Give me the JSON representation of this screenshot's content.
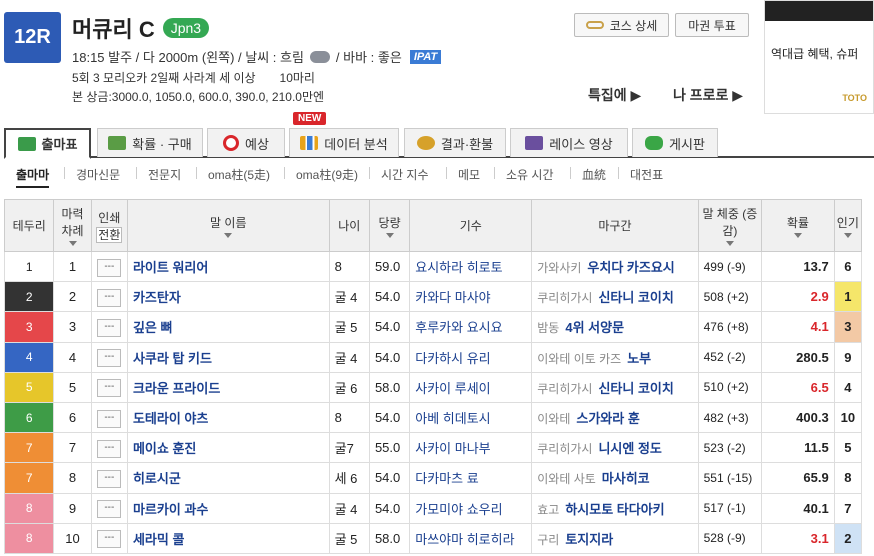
{
  "header": {
    "race_no": "12R",
    "race_name": "머큐리 C",
    "grade": "Jpn3",
    "info_line1": "18:15 발주 / 다 2000m (왼쪽) / 날씨 : 흐림",
    "track_state": "/ 바바 : 좋은",
    "ipat_label": "IPAT",
    "info_line2": "5회 3 모리오카 2일째 사라계 세 이상　　10마리",
    "info_line3": "본 상금:3000.0, 1050.0, 600.0, 390.0, 210.0만엔",
    "course_btn": "코스 상세",
    "ticket_btn": "마권 투표",
    "prev_link": "특집에 ▶",
    "next_link": "나 프로로 ▶"
  },
  "ad": {
    "text": "역대급 혜택, 슈퍼",
    "logo": "TOTO"
  },
  "tabs": [
    {
      "label": "출마표",
      "icon": "table-icon",
      "color": "#3a9b4a"
    },
    {
      "label": "확률 · 구매",
      "icon": "chart-icon",
      "color": "#5a9c45"
    },
    {
      "label": "예상",
      "icon": "target-icon",
      "color": "#d9262b"
    },
    {
      "label": "데이터 분석",
      "icon": "bar-icon",
      "color": "#e8a31b"
    },
    {
      "label": "결과·환불",
      "icon": "coins-icon",
      "color": "#d6a12a"
    },
    {
      "label": "레이스 영상",
      "icon": "video-icon",
      "color": "#6a4f9e"
    },
    {
      "label": "게시판",
      "icon": "chat-icon",
      "color": "#3aa646"
    }
  ],
  "new_badge": "NEW",
  "subnav": [
    "출마마",
    "경마신문",
    "전문지",
    "oma柱(5走)",
    "oma柱(9走)",
    "시간 지수",
    "메모",
    "소유 시간",
    "血統",
    "대전표"
  ],
  "table": {
    "headers": {
      "waku": "테두리",
      "num": "마력 차례",
      "mark": "인쇄",
      "mark_sub": "전환",
      "name": "말 이름",
      "age": "나이",
      "weight": "당량",
      "jockey": "기수",
      "trainer": "마구간",
      "bw": "말 체중 (증감)",
      "odds": "확률",
      "pop": "인기"
    },
    "mark_label": "---",
    "rows": [
      {
        "waku": "1",
        "waku_bg": "#ffffff",
        "waku_fg": "#222222",
        "num": "1",
        "name": "라이트 워리어",
        "age": "8",
        "weight": "59.0",
        "jockey": "요시하라 히로토",
        "region": "가와사키",
        "trainer": "우치다 카즈요시",
        "bw": "499 (-9)",
        "odds": "13.7",
        "odds_color": "#222222",
        "pop": "6",
        "pop_bg": "#ffffff"
      },
      {
        "waku": "2",
        "waku_bg": "#333333",
        "waku_fg": "#ffffff",
        "num": "2",
        "name": "카즈탄자",
        "age": "굴 4",
        "weight": "54.0",
        "jockey": "카와다 마사야",
        "region": "쿠리히가시",
        "trainer": "신타니 코이치",
        "bw": "508 (+2)",
        "odds": "2.9",
        "odds_color": "#d9262b",
        "pop": "1",
        "pop_bg": "#f5e66a"
      },
      {
        "waku": "3",
        "waku_bg": "#e5474a",
        "waku_fg": "#ffffff",
        "num": "3",
        "name": "깊은 뼈",
        "age": "굴 5",
        "weight": "54.0",
        "jockey": "후루카와 요시요",
        "region": "밤동",
        "trainer": "4위 서양문",
        "bw": "476 (+8)",
        "odds": "4.1",
        "odds_color": "#d9262b",
        "pop": "3",
        "pop_bg": "#f3c9a5"
      },
      {
        "waku": "4",
        "waku_bg": "#3566c3",
        "waku_fg": "#ffffff",
        "num": "4",
        "name": "사쿠라 탑 키드",
        "age": "굴 4",
        "weight": "54.0",
        "jockey": "다카하시 유리",
        "region": "이와테 이토 카즈",
        "trainer": "노부",
        "bw": "452 (-2)",
        "odds": "280.5",
        "odds_color": "#222222",
        "pop": "9",
        "pop_bg": "#ffffff"
      },
      {
        "waku": "5",
        "waku_bg": "#e6c62a",
        "waku_fg": "#ffffff",
        "num": "5",
        "name": "크라운 프라이드",
        "age": "굴 6",
        "weight": "58.0",
        "jockey": "사카이 루세이",
        "region": "쿠리히가시",
        "trainer": "신타니 코이치",
        "bw": "510 (+2)",
        "odds": "6.5",
        "odds_color": "#d9262b",
        "pop": "4",
        "pop_bg": "#ffffff"
      },
      {
        "waku": "6",
        "waku_bg": "#3e9c47",
        "waku_fg": "#ffffff",
        "num": "6",
        "name": "도테라이 야츠",
        "age": "8",
        "weight": "54.0",
        "jockey": "아베 히데토시",
        "region": "이와테",
        "trainer": "스가와라 훈",
        "bw": "482 (+3)",
        "odds": "400.3",
        "odds_color": "#222222",
        "pop": "10",
        "pop_bg": "#ffffff"
      },
      {
        "waku": "7",
        "waku_bg": "#ef8e35",
        "waku_fg": "#ffffff",
        "num": "7",
        "name": "메이쇼 훈진",
        "age": "굴7",
        "weight": "55.0",
        "jockey": "사카이 마나부",
        "region": "쿠리히가시",
        "trainer": "니시엔 정도",
        "bw": "523 (-2)",
        "odds": "11.5",
        "odds_color": "#222222",
        "pop": "5",
        "pop_bg": "#ffffff"
      },
      {
        "waku": "7",
        "waku_bg": "#ef8e35",
        "waku_fg": "#ffffff",
        "num": "8",
        "name": "히로시군",
        "age": "세 6",
        "weight": "54.0",
        "jockey": "다카마츠 료",
        "region": "이와테 사토",
        "trainer": "마사히코",
        "bw": "551 (-15)",
        "odds": "65.9",
        "odds_color": "#222222",
        "pop": "8",
        "pop_bg": "#ffffff"
      },
      {
        "waku": "8",
        "waku_bg": "#ee8fa0",
        "waku_fg": "#ffffff",
        "num": "9",
        "name": "마르카이 과수",
        "age": "굴 4",
        "weight": "54.0",
        "jockey": "가모미야 쇼우리",
        "region": "효고",
        "trainer": "하시모토 타다아키",
        "bw": "517 (-1)",
        "odds": "40.1",
        "odds_color": "#222222",
        "pop": "7",
        "pop_bg": "#ffffff"
      },
      {
        "waku": "8",
        "waku_bg": "#ee8fa0",
        "waku_fg": "#ffffff",
        "num": "10",
        "name": "세라믹 콜",
        "age": "굴 5",
        "weight": "58.0",
        "jockey": "마쓰야마 히로히라",
        "region": "구리",
        "trainer": "토지지라",
        "bw": "528 (-9)",
        "odds": "3.1",
        "odds_color": "#d9262b",
        "pop": "2",
        "pop_bg": "#cfe2f5"
      }
    ]
  }
}
